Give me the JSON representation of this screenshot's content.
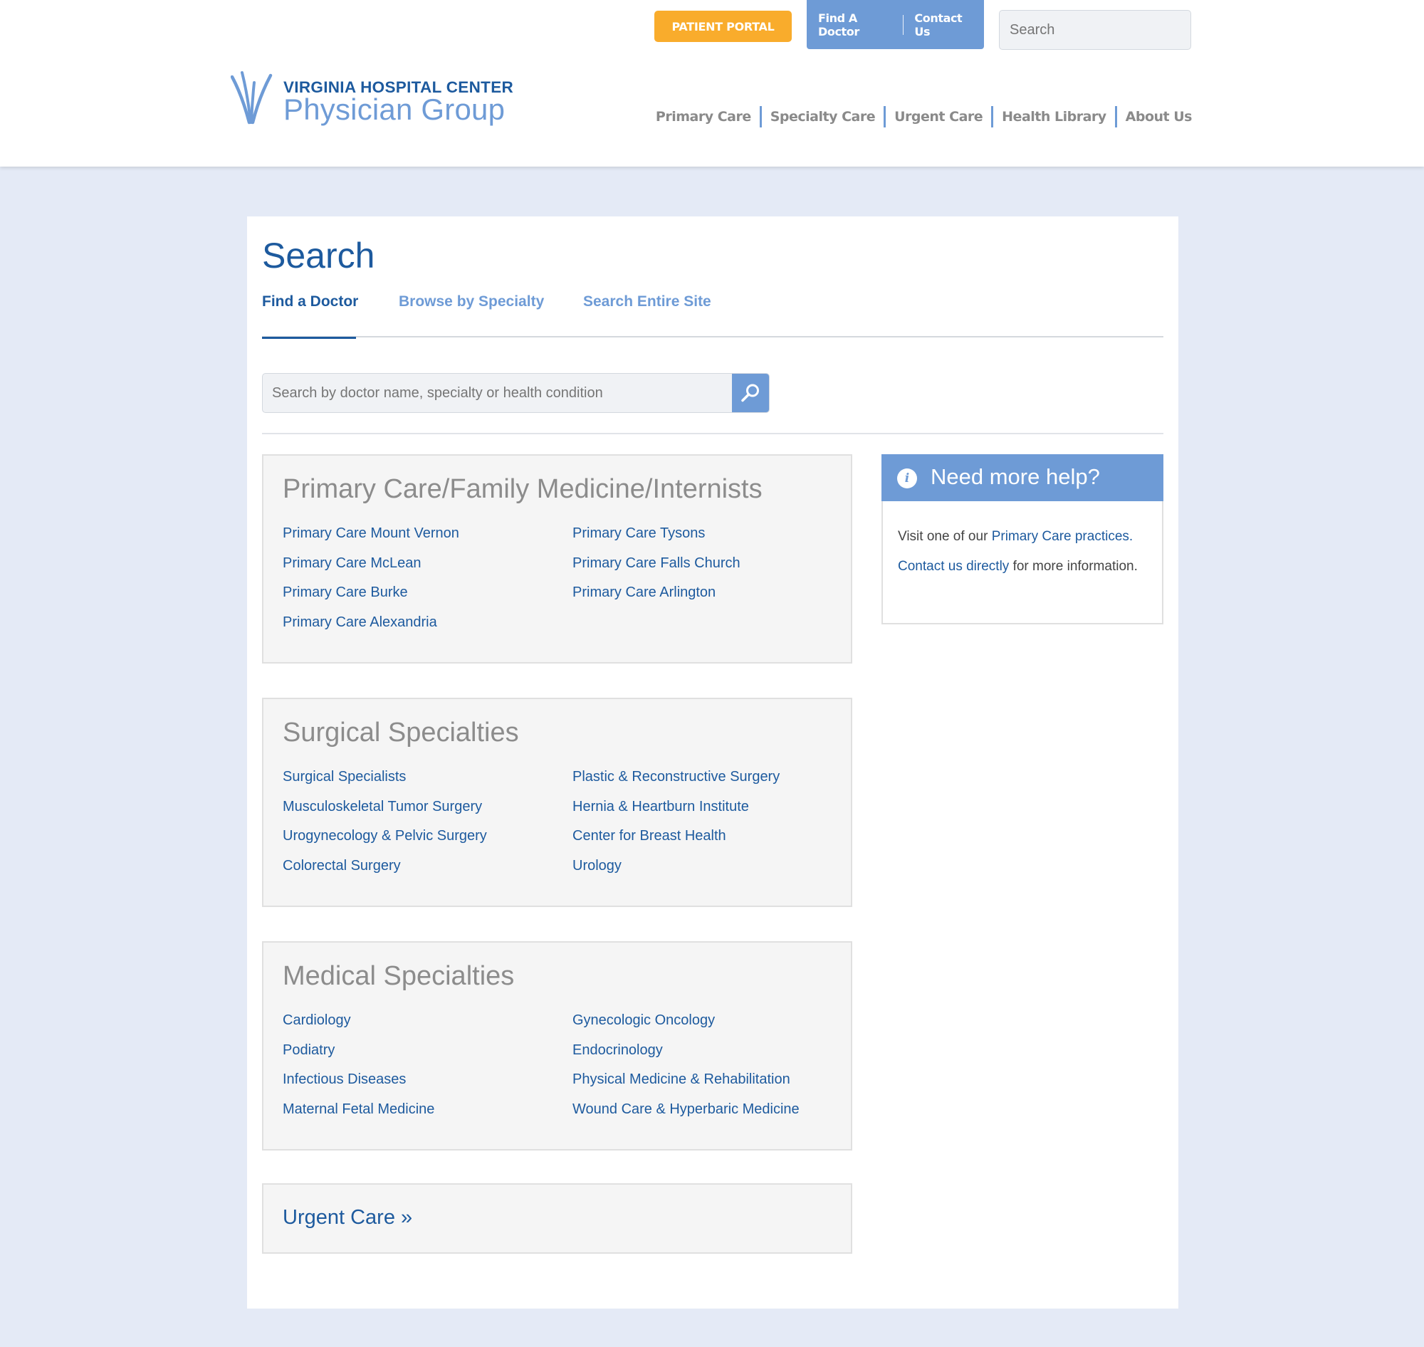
{
  "header": {
    "patient_portal": "PATIENT PORTAL",
    "find_a_doctor": "Find A Doctor",
    "contact_us": "Contact Us",
    "search_placeholder": "Search",
    "logo_line1": "VIRGINIA HOSPITAL CENTER",
    "logo_line2": "Physician Group",
    "nav": [
      "Primary Care",
      "Specialty Care",
      "Urgent Care",
      "Health Library",
      "About Us"
    ]
  },
  "page": {
    "title": "Search",
    "tabs": [
      "Find a Doctor",
      "Browse by Specialty",
      "Search Entire Site"
    ],
    "search_placeholder": "Search by doctor name, specialty or health condition"
  },
  "sections": [
    {
      "title": "Primary Care/Family Medicine/Internists",
      "left": [
        "Primary Care Mount Vernon",
        "Primary Care McLean",
        "Primary Care Burke",
        "Primary Care Alexandria"
      ],
      "right": [
        "Primary Care Tysons",
        "Primary Care Falls Church",
        "Primary Care Arlington"
      ]
    },
    {
      "title": "Surgical Specialties",
      "left": [
        "Surgical Specialists",
        "Musculoskeletal Tumor Surgery",
        "Urogynecology & Pelvic Surgery",
        "Colorectal Surgery"
      ],
      "right": [
        "Plastic & Reconstructive Surgery",
        "Hernia & Heartburn Institute",
        "Center for Breast Health",
        "Urology"
      ]
    },
    {
      "title": "Medical Specialties",
      "left": [
        "Cardiology",
        "Podiatry",
        "Infectious Diseases",
        "Maternal Fetal Medicine"
      ],
      "right": [
        "Gynecologic Oncology",
        "Endocrinology",
        "Physical Medicine & Rehabilitation",
        "Wound Care & Hyperbaric Medicine"
      ]
    }
  ],
  "urgent_care_link": "Urgent Care »",
  "help": {
    "title": "Need more help?",
    "line1_prefix": "Visit one of our ",
    "line1_link": "Primary Care practices.",
    "line2_link": "Contact us directly",
    "line2_suffix": " for more information."
  },
  "colors": {
    "brand_dark": "#1d5a9e",
    "brand_light": "#6e9bd6",
    "portal_orange": "#f9ac2c",
    "page_bg": "#e4eaf6"
  },
  "icons": [
    "search-icon",
    "info-icon",
    "logo-mark"
  ]
}
